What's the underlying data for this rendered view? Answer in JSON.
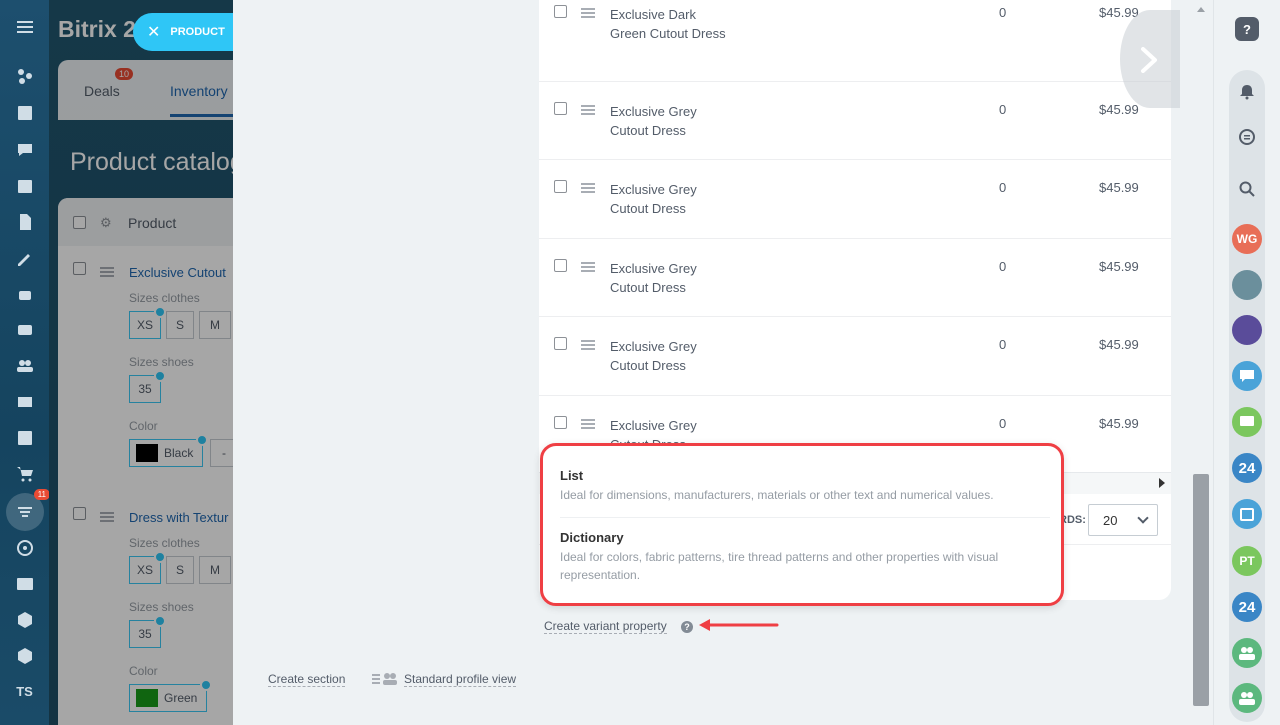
{
  "left_rail": {
    "badge_filter": "11",
    "footer_label": "TS",
    "icons": [
      "sitemap-icon",
      "news-feed-icon",
      "chat-icon",
      "calendar-icon",
      "document-icon",
      "signature-icon",
      "robot-icon",
      "drive-icon",
      "team-icon",
      "mail-icon",
      "tasks-icon",
      "cart-icon",
      "filter-icon",
      "target-icon",
      "contact-card-icon",
      "inventory-box-icon",
      "catalog-box-icon"
    ]
  },
  "background": {
    "brand": "Bitrix 2",
    "product_chip": "PRODUCT",
    "tab_deals": "Deals",
    "tab_deals_badge": "10",
    "tab_inventory": "Inventory",
    "page_title": "Product catalog",
    "grid_header_product": "Product",
    "products": [
      {
        "name": "Exclusive Cutout",
        "sizes_clothes_label": "Sizes clothes",
        "sizes_clothes": [
          "XS",
          "S",
          "M"
        ],
        "sizes_shoes_label": "Sizes shoes",
        "sizes_shoes": [
          "35"
        ],
        "color_label": "Color",
        "color_value": "Black",
        "color_hex": "#000000"
      },
      {
        "name": "Dress with Textur",
        "sizes_clothes_label": "Sizes clothes",
        "sizes_clothes": [
          "XS",
          "S",
          "M"
        ],
        "sizes_shoes_label": "Sizes shoes",
        "sizes_shoes": [
          "35"
        ],
        "color_label": "Color",
        "color_value": "Green",
        "color_hex": "#1a9c1a"
      }
    ]
  },
  "variants_table": {
    "rows": [
      {
        "name": "Exclusive Dark Green Cutout Dress",
        "qty": "0",
        "price": "$45.99"
      },
      {
        "name": "Exclusive Grey Cutout Dress",
        "qty": "0",
        "price": "$45.99"
      },
      {
        "name": "Exclusive Grey Cutout Dress",
        "qty": "0",
        "price": "$45.99"
      },
      {
        "name": "Exclusive Grey Cutout Dress",
        "qty": "0",
        "price": "$45.99"
      },
      {
        "name": "Exclusive Grey Cutout Dress",
        "qty": "0",
        "price": "$45.99"
      },
      {
        "name": "Exclusive Grey Cutout Dress",
        "qty": "0",
        "price": "$45.99"
      }
    ],
    "records_label": "RDS:",
    "records_value": "20"
  },
  "popup": {
    "list_title": "List",
    "list_desc": "Ideal for dimensions, manufacturers, materials or other text and numerical values.",
    "dictionary_title": "Dictionary",
    "dictionary_desc": "Ideal for colors, fabric patterns, tire thread patterns and other properties with visual representation.",
    "accent_color": "#ef3f44"
  },
  "footer": {
    "create_variant_property": "Create variant property",
    "help": "?",
    "create_section": "Create section",
    "standard_profile_view": "Standard profile view"
  },
  "right_rail": {
    "help": "?",
    "avatar_wg": "WG",
    "avatar_pt": "PT",
    "bitrix_24_a": "24",
    "bitrix_24_b": "24"
  }
}
